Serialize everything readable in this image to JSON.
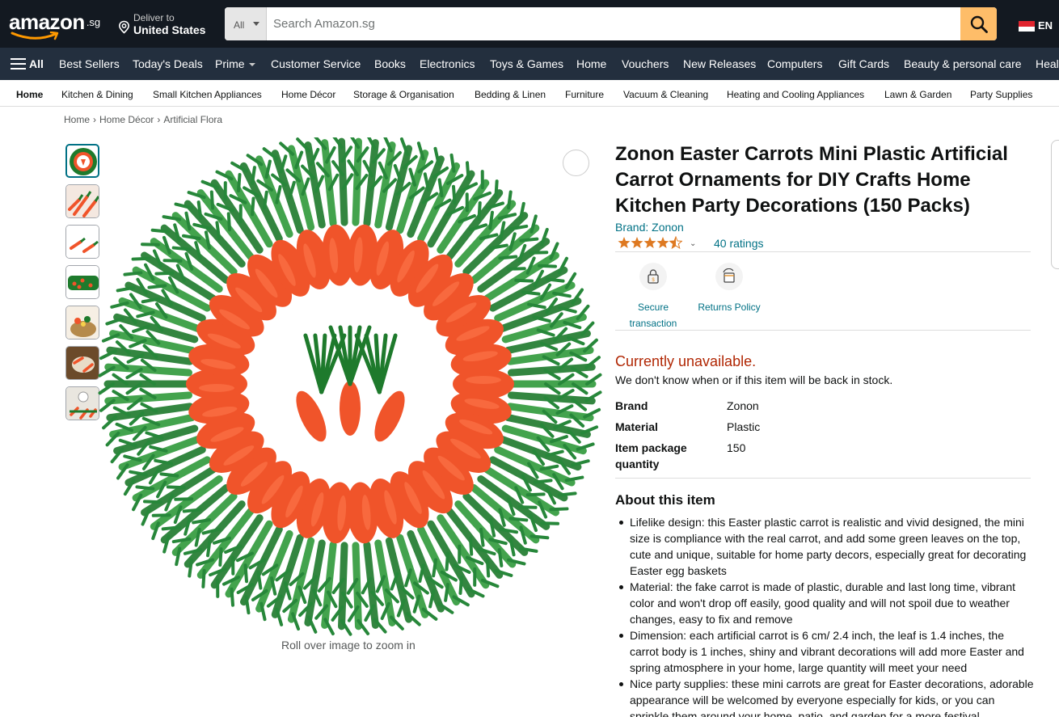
{
  "header": {
    "logo_text": "amazon",
    "logo_tld": ".sg",
    "deliver_label": "Deliver to",
    "deliver_location": "United States",
    "search_category": "All",
    "search_placeholder": "Search Amazon.sg",
    "language": "EN"
  },
  "main_nav": {
    "all_label": "All",
    "items": [
      "Best Sellers",
      "Today's Deals",
      "Prime",
      "Customer Service",
      "Books",
      "Electronics",
      "Toys & Games",
      "Home",
      "Vouchers",
      "New Releases",
      "Computers",
      "Gift Cards",
      "Beauty & personal care",
      "Heal"
    ]
  },
  "sub_nav": {
    "items": [
      "Home",
      "Kitchen & Dining",
      "Small Kitchen Appliances",
      "Home Décor",
      "Storage & Organisation",
      "Bedding & Linen",
      "Furniture",
      "Vacuum & Cleaning",
      "Heating and Cooling Appliances",
      "Lawn & Garden",
      "Party Supplies"
    ]
  },
  "breadcrumb": [
    "Home",
    "Home Décor",
    "Artificial Flora"
  ],
  "breadcrumb_sep": "›",
  "gallery": {
    "zoom_hint": "Roll over image to zoom in"
  },
  "product": {
    "title": "Zonon Easter Carrots Mini Plastic Artificial Carrot Ornaments for DIY Crafts Home Kitchen Party Decorations (150 Packs)",
    "brand_link": "Brand: Zonon",
    "rating_stars": 4.5,
    "ratings_count": "40 ratings",
    "badges": [
      {
        "line1": "Secure",
        "line2": "transaction"
      },
      {
        "line1": "Returns Policy",
        "line2": ""
      }
    ],
    "availability": "Currently unavailable.",
    "availability_note": "We don't know when or if this item will be back in stock.",
    "specs": [
      {
        "key": "Brand",
        "value": "Zonon"
      },
      {
        "key": "Material",
        "value": "Plastic"
      },
      {
        "key": "Item package quantity",
        "value": "150"
      }
    ],
    "about_heading": "About this item",
    "about_items": [
      "Lifelike design: this Easter plastic carrot is realistic and vivid designed, the mini size is compliance with the real carrot, and add some green leaves on the top, cute and unique, suitable for home party decors, especially great for decorating Easter egg baskets",
      "Material: the fake carrot is made of plastic, durable and last long time, vibrant color and won't drop off easily, good quality and will not spoil due to weather changes, easy to fix and remove",
      "Dimension: each artificial carrot is 6 cm/ 2.4 inch, the leaf is 1.4 inches, the carrot body is 1 inches, shiny and vibrant decorations will add more Easter and spring atmosphere in your home, large quantity will meet your need",
      "Nice party supplies: these mini carrots are great for Easter decorations, adorable appearance will be welcomed by everyone especially for kids, or you can sprinkle them around your home, patio, and garden for a more festival"
    ]
  },
  "colors": {
    "nav_dark": "#131921",
    "nav_mid": "#232f3e",
    "link": "#007185",
    "unavailable": "#b12704",
    "search_button": "#febd69",
    "star": "#de7921",
    "carrot": "#f0542a",
    "leaf": "#1e7a2c"
  }
}
